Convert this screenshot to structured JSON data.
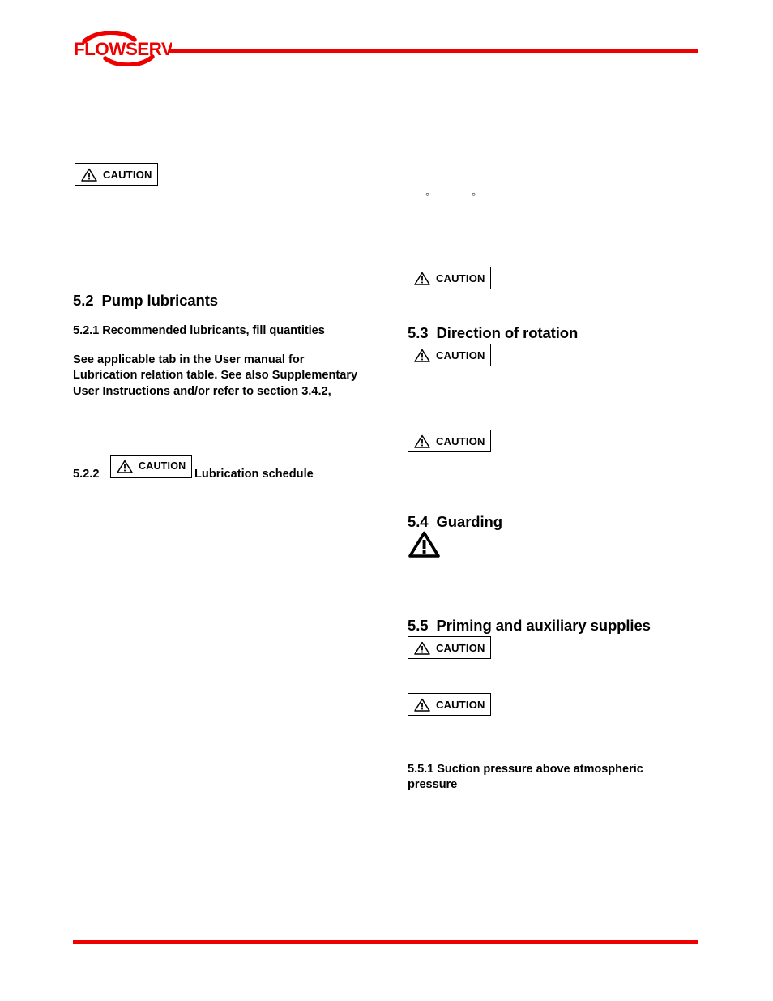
{
  "document": {
    "brand": "FLOWSERVE",
    "accent_color": "#ee0000"
  },
  "caution": {
    "label": "CAUTION",
    "icon": "warning-triangle-icon"
  },
  "left_column": {
    "caution_top": "CAUTION",
    "section_5_2": {
      "number": "5.2",
      "title": "Pump lubricants"
    },
    "section_5_2_1": {
      "heading": "5.2.1  Recommended lubricants, fill quantities",
      "body": "See applicable tab in the User manual for Lubrication relation table. See also Supplementary User Instructions and/or refer to section 3.4.2,"
    },
    "section_5_2_2": {
      "number": "5.2.2",
      "caution": "CAUTION",
      "title": "Lubrication schedule"
    }
  },
  "right_column": {
    "degree_marks": [
      "°",
      "°"
    ],
    "caution_top": "CAUTION",
    "section_5_3": {
      "number": "5.3",
      "title": "Direction of rotation",
      "caution_1": "CAUTION",
      "caution_2": "CAUTION"
    },
    "section_5_4": {
      "number": "5.4",
      "title": "Guarding",
      "warning_icon": "warning-triangle-icon"
    },
    "section_5_5": {
      "number": "5.5",
      "title": "Priming and auxiliary supplies",
      "caution_1": "CAUTION",
      "caution_2": "CAUTION"
    },
    "section_5_5_1": {
      "heading": "5.5.1  Suction pressure above atmospheric pressure"
    }
  }
}
